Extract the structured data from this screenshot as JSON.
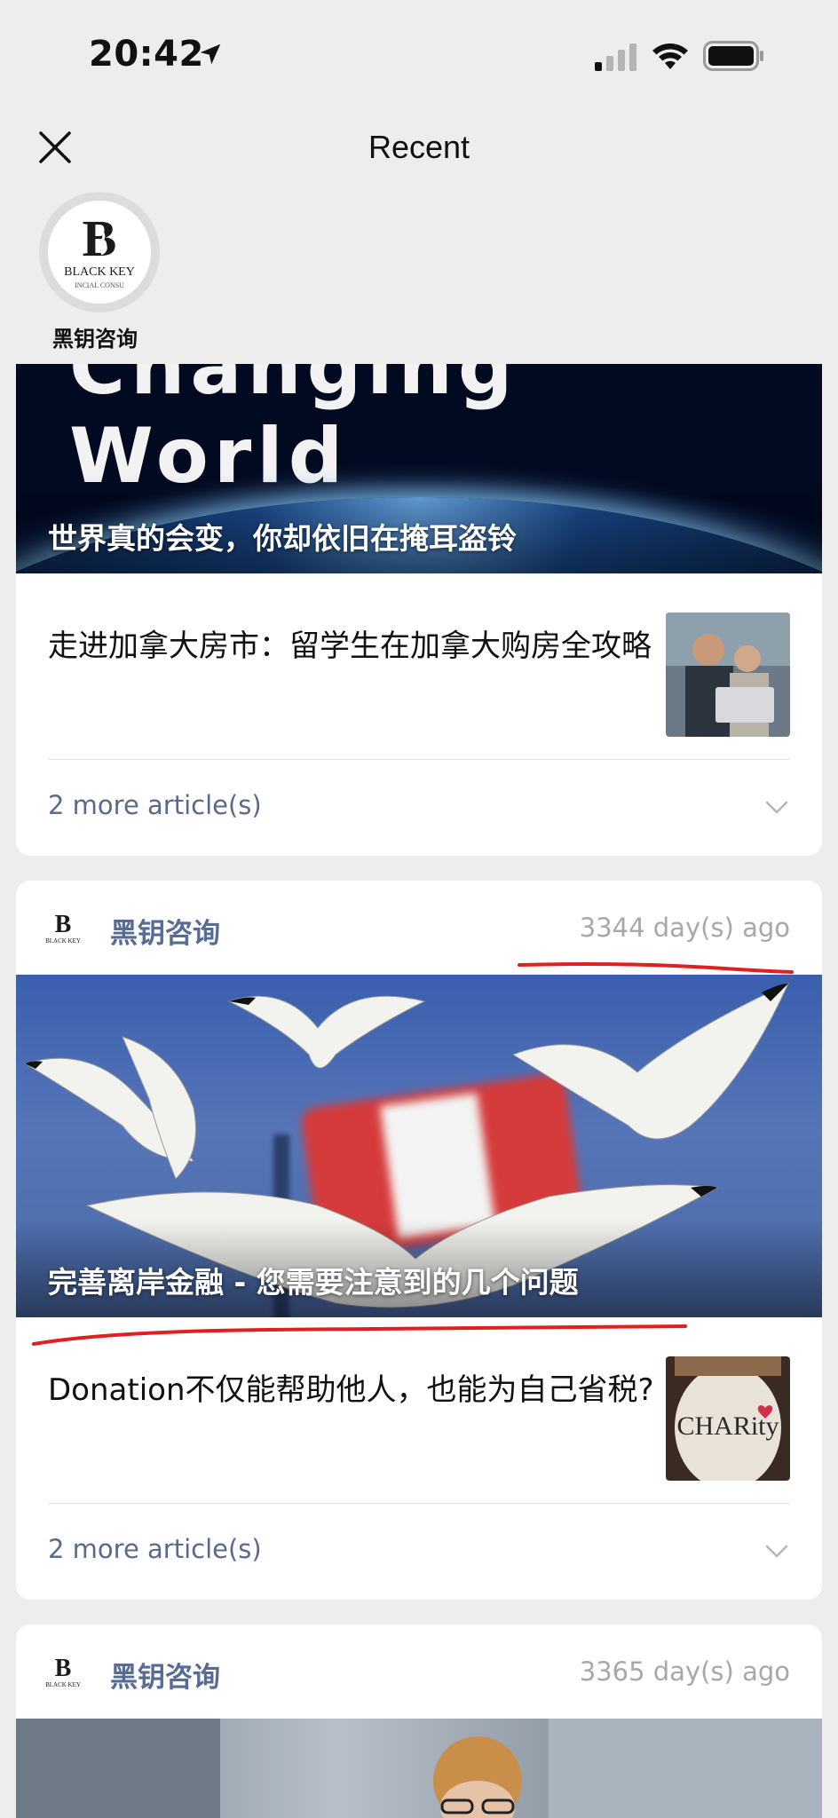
{
  "status_bar": {
    "time": "20:42",
    "icons": [
      "location-arrow-icon",
      "cellular-signal-icon",
      "wifi-icon",
      "battery-icon"
    ]
  },
  "nav": {
    "title": "Recent",
    "close_icon": "close-icon"
  },
  "account": {
    "name": "黑钥咨询",
    "logo_text": "BLACK KEY",
    "logo_subtext": "INCIAL CONSU"
  },
  "cards": [
    {
      "hero_caption": "世界真的会变，你却依旧在掩耳盗铃",
      "hero_banner_text": "Changing World",
      "article_title": "走进加拿大房市：留学生在加拿大购房全攻略",
      "more_label": "2 more article(s)"
    },
    {
      "account_name": "黑钥咨询",
      "time_ago": "3344 day(s) ago",
      "hero_caption": "完善离岸金融 - 您需要注意到的几个问题",
      "article_title": "Donation不仅能帮助他人，也能为自己省税?",
      "more_label": "2 more article(s)",
      "thumb_text": "CHARity"
    },
    {
      "account_name": "黑钥咨询",
      "time_ago": "3365 day(s) ago"
    }
  ],
  "colors": {
    "background": "#ededed",
    "link_blue": "#576b95",
    "muted": "#a8a8a8",
    "annotation_red": "#e02020"
  }
}
